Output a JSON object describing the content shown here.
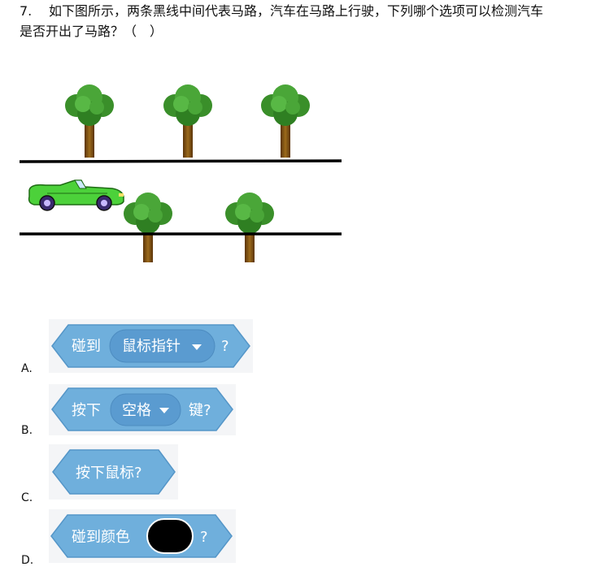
{
  "question": {
    "number": "7.",
    "line1": "如下图所示，两条黑线中间代表马路，汽车在马路上行驶，下列哪个选项可以检测汽车",
    "line2": "是否开出了马路？（　）"
  },
  "colors": {
    "block_fill": "#6fafdc",
    "block_stroke": "#5596c8",
    "dropdown_fill": "#5a9bd0",
    "road_line": "#000000",
    "car_body": "#4cd13a",
    "tree_leaves": "#3e9a2d",
    "tree_trunk": "#7a4a12"
  },
  "options": [
    {
      "letter": "A.",
      "block": {
        "text1": "碰到",
        "dropdown": "鼠标指针",
        "suffix": "?"
      }
    },
    {
      "letter": "B.",
      "block": {
        "text1": "按下",
        "dropdown": "空格",
        "suffix": "键?"
      }
    },
    {
      "letter": "C.",
      "block": {
        "text1": "按下鼠标?"
      }
    },
    {
      "letter": "D.",
      "block": {
        "text1": "碰到颜色",
        "color_swatch": "#000000",
        "suffix": "?"
      }
    }
  ]
}
